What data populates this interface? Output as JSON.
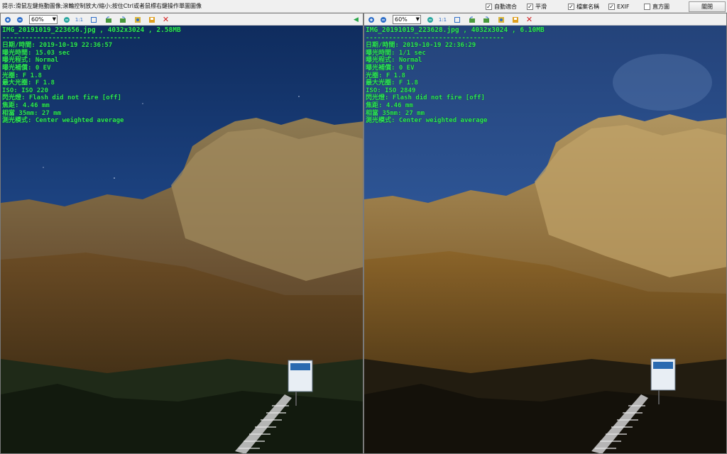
{
  "topbar": {
    "hint": "提示:滑鼠左鍵拖動圖像;滾輪控制放大/縮小;按住Ctrl或者鼠標右鍵操作單圖圖像",
    "options": [
      {
        "label": "自動適合",
        "checked": true
      },
      {
        "label": "平滑",
        "checked": true
      },
      {
        "label": "檔案名稱",
        "checked": true
      },
      {
        "label": "EXIF",
        "checked": true
      },
      {
        "label": "直方圖",
        "checked": false
      }
    ],
    "close_label": "關閉"
  },
  "panes": [
    {
      "zoom": "60%",
      "filename_line": "IMG_20191019_223656.jpg , 4032x3024 , 2.58MB",
      "separator": "------------------------------------",
      "exif": [
        "日期/時間: 2019-10-19 22:36:57",
        "曝光時間: 15.03 sec",
        "曝光程式: Normal",
        "曝光補償: 0 EV",
        "光圈: F 1.8",
        "最大光圈: F 1.8",
        "ISO: ISO 220",
        "閃光燈: Flash did not fire [off]",
        "焦距: 4.46 mm",
        "相當 35mm: 27 mm",
        "測光模式: Center weighted average"
      ]
    },
    {
      "zoom": "60%",
      "filename_line": "IMG_20191019_223628.jpg , 4032x3024 , 6.10MB",
      "separator": "------------------------------------",
      "exif": [
        "日期/時間: 2019-10-19 22:36:29",
        "曝光時間: 1/1 sec",
        "曝光程式: Normal",
        "曝光補償: 0 EV",
        "光圈: F 1.8",
        "最大光圈: F 1.8",
        "ISO: ISO 2849",
        "閃光燈: Flash did not fire [off]",
        "焦距: 4.46 mm",
        "相當 35mm: 27 mm",
        "測光模式: Center weighted average"
      ]
    }
  ],
  "toolbar_buttons": [
    "zoom-in-icon",
    "zoom-out-icon",
    "zoom-dropdown",
    "fit-icon",
    "actual-size-label",
    "fullscreen-icon",
    "rotate-left-icon",
    "rotate-right-icon",
    "flip-icon",
    "save-icon",
    "delete-icon"
  ],
  "actual_size_label": "1:1",
  "colors": {
    "exif_text": "#2ee65a",
    "delete": "#d42020",
    "arrow": "#2aa84a"
  }
}
